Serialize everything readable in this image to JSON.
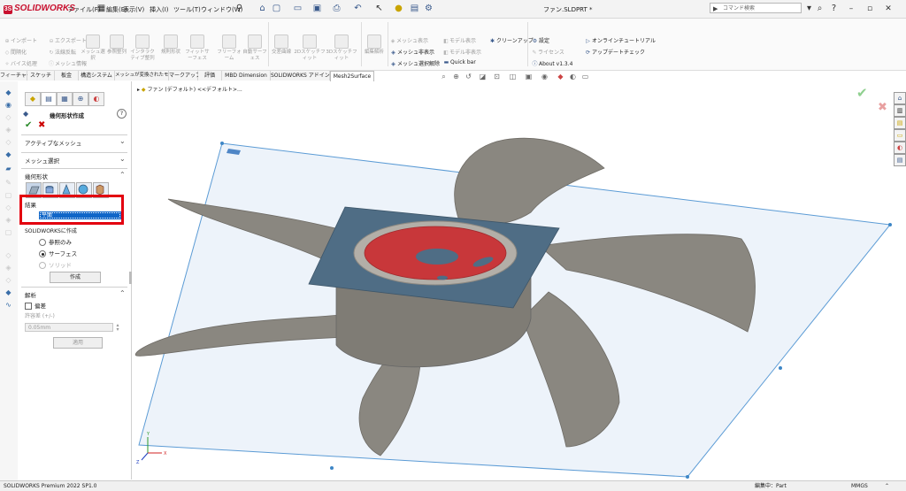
{
  "app": {
    "name": "SOLIDWORKS",
    "document_title": "ファン.SLDPRT *"
  },
  "menu": [
    "ファイル(F)",
    "編集(E)",
    "表示(V)",
    "挿入(I)",
    "ツール(T)",
    "ウィンドウ(W)"
  ],
  "search": {
    "placeholder": "コマンド検索"
  },
  "command_manager": {
    "mesh_group_a": [
      "インポート",
      "間隔化",
      "バイス処理"
    ],
    "mesh_group_b": [
      "エクスポート",
      "法線反転",
      "メッシュ情報"
    ],
    "mesh_group_c": [
      "メッシュ選択",
      "参照整列",
      "インタラクティブ整列",
      "規則形状",
      "フィットサーフェス",
      "フリーフォーム",
      "自動サーフェス",
      "交差曲線",
      "2Dスケッチフィット",
      "3Dスケッチフィット"
    ],
    "display_items": [
      "メッシュ表示",
      "メッシュ非表示",
      "メッシュ選択解除"
    ],
    "model_items": [
      "モデル表示",
      "モデル非表示"
    ],
    "misc_items": [
      "クリーンアップ",
      "Quick bar"
    ],
    "settings": [
      "設定",
      "ライセンス",
      "About v1.3.4"
    ],
    "help": [
      "オンラインチュートリアル",
      "アップデートチェック"
    ],
    "edit_button": "編集解析"
  },
  "tabs": [
    "フィーチャー",
    "スケッチ",
    "板金",
    "構造システム",
    "メッシュが変換されたモデル",
    "マークアップ",
    "評価",
    "MBD Dimension",
    "SOLIDWORKS アドイン",
    "Mesh2Surface"
  ],
  "active_tab": "Mesh2Surface",
  "feature_tree": {
    "item": "ファン (デフォルト) <<デフォルト>..."
  },
  "property_manager": {
    "title": "幾何形状作成",
    "sections": {
      "active_mesh": "アクティブなメッシュ",
      "mesh_select": "メッシュ選択",
      "geometry": "幾何形状",
      "result": "結果",
      "result_value": "平面",
      "solidworks_label": "SOLIDWORKSに作成",
      "options": [
        "参照のみ",
        "サーフェス",
        "ソリッド"
      ],
      "selected_option": "サーフェス",
      "create_button": "作成",
      "analysis": "解析",
      "deviation": "偏差",
      "tolerance_label": "許容差 (+/-)",
      "tolerance_value": "0.05mm",
      "apply_button": "適用"
    }
  },
  "status": {
    "version": "SOLIDWORKS Premium 2022 SP1.0",
    "editing": "編集中：Part",
    "units": "MMGS"
  },
  "colors": {
    "brand_red": "#c8102e",
    "highlight": "#e3000f",
    "selection_blue": "#1066c8",
    "plane_fill": "#dfeaf5",
    "fan_gray": "#8a8780",
    "cut_plane": "#4f6d85",
    "hub_red": "#c8373a"
  }
}
